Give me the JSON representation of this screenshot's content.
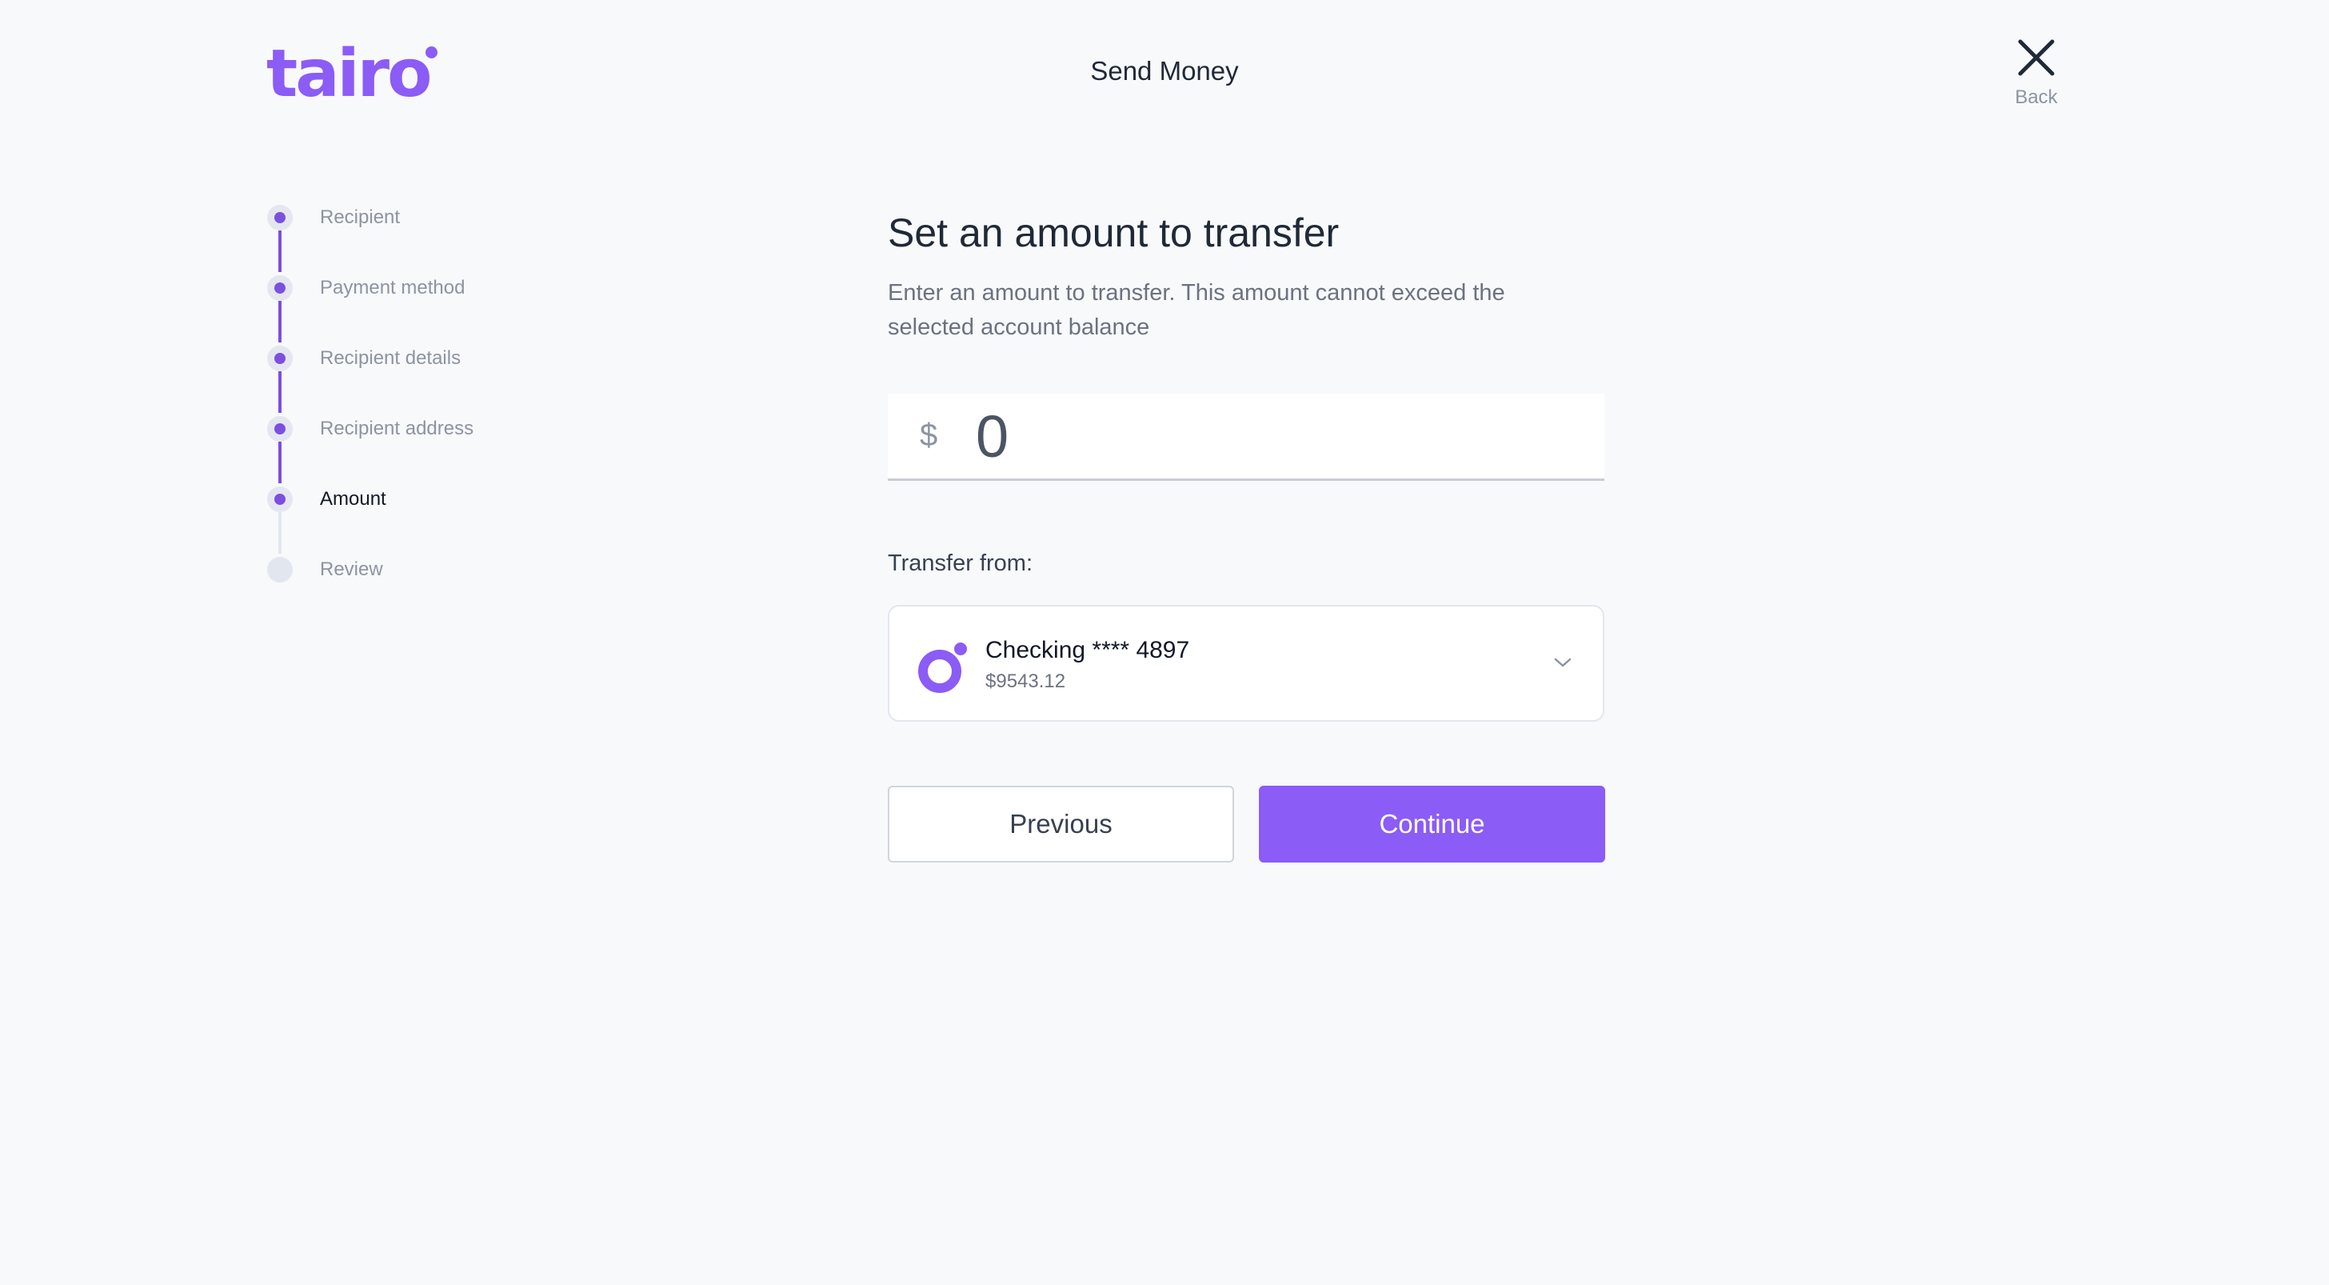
{
  "brand": {
    "logo_text": "tairo",
    "accent_color": "#8b5cf6"
  },
  "header": {
    "title": "Send Money",
    "back_icon": "close-icon",
    "back_label": "Back"
  },
  "stepper": {
    "steps": [
      {
        "label": "Recipient",
        "state": "complete"
      },
      {
        "label": "Payment method",
        "state": "complete"
      },
      {
        "label": "Recipient details",
        "state": "complete"
      },
      {
        "label": "Recipient address",
        "state": "complete"
      },
      {
        "label": "Amount",
        "state": "active"
      },
      {
        "label": "Review",
        "state": "pending"
      }
    ]
  },
  "form": {
    "heading": "Set an amount to transfer",
    "description": "Enter an amount to transfer. This amount cannot exceed the selected account balance",
    "currency_symbol": "$",
    "amount_value": "0",
    "transfer_from_label": "Transfer from:",
    "account": {
      "name": "Checking **** 4897",
      "balance": "$9543.12",
      "icon": "account-logo-icon"
    },
    "dropdown_icon": "chevron-down-icon"
  },
  "actions": {
    "previous_label": "Previous",
    "continue_label": "Continue"
  }
}
